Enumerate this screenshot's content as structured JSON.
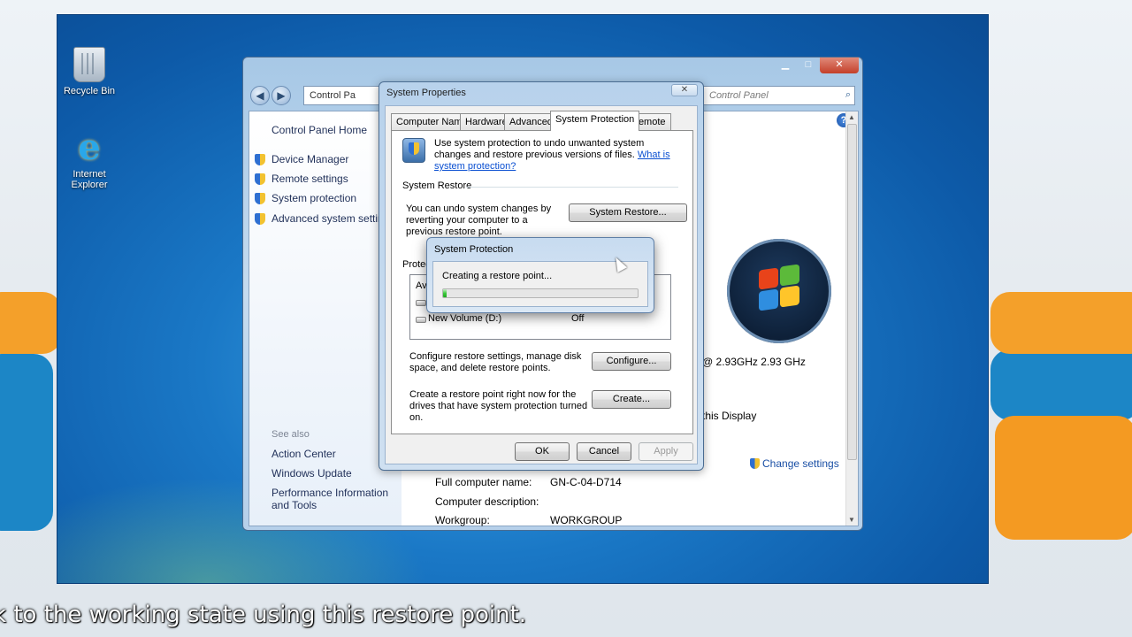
{
  "desktop": {
    "icons": [
      {
        "label": "Recycle Bin",
        "icon": "recycle-bin-icon"
      },
      {
        "label": "Internet Explorer",
        "icon": "internet-explorer-icon"
      }
    ]
  },
  "control_panel": {
    "address_text": "Control Pa",
    "search_placeholder": "Control Panel",
    "left_nav": {
      "home": "Control Panel Home",
      "items": [
        "Device Manager",
        "Remote settings",
        "System protection",
        "Advanced system settings"
      ],
      "see_also_label": "See also",
      "see_also": [
        "Action Center",
        "Windows Update",
        "Performance Information and Tools"
      ]
    },
    "details": {
      "processor_suffix": "@ 2.93GHz   2.93 GHz",
      "display_suffix": "this Display",
      "change_settings": "Change settings",
      "rows": [
        {
          "label": "Full computer name:",
          "value": "GN-C-04-D714"
        },
        {
          "label": "Computer description:",
          "value": ""
        },
        {
          "label": "Workgroup:",
          "value": "WORKGROUP"
        }
      ]
    }
  },
  "system_properties": {
    "title": "System Properties",
    "tabs": [
      "Computer Name",
      "Hardware",
      "Advanced",
      "System Protection",
      "Remote"
    ],
    "active_tab": "System Protection",
    "intro_text": "Use system protection to undo unwanted system changes and restore previous versions of files.",
    "intro_link": "What is system protection?",
    "system_restore_label": "System Restore",
    "system_restore_text": "You can undo system changes by reverting your computer to a previous restore point.",
    "system_restore_button": "System Restore...",
    "protection_label": "Protecti",
    "list_header": "Ava",
    "drives": [
      {
        "name": "",
        "status": ""
      },
      {
        "name": "New Volume (D:)",
        "status": "Off"
      }
    ],
    "configure_text": "Configure restore settings, manage disk space, and delete restore points.",
    "configure_button": "Configure...",
    "create_text": "Create a restore point right now for the drives that have system protection turned on.",
    "create_button": "Create...",
    "ok": "OK",
    "cancel": "Cancel",
    "apply": "Apply"
  },
  "progress_dialog": {
    "title": "System Protection",
    "message": "Creating a restore point...",
    "progress": 0.02
  },
  "caption": "k to the working state using this restore point.",
  "colors": {
    "accent": "#1a78c6",
    "progress": "#3cc93c",
    "link": "#0a4fd1"
  }
}
